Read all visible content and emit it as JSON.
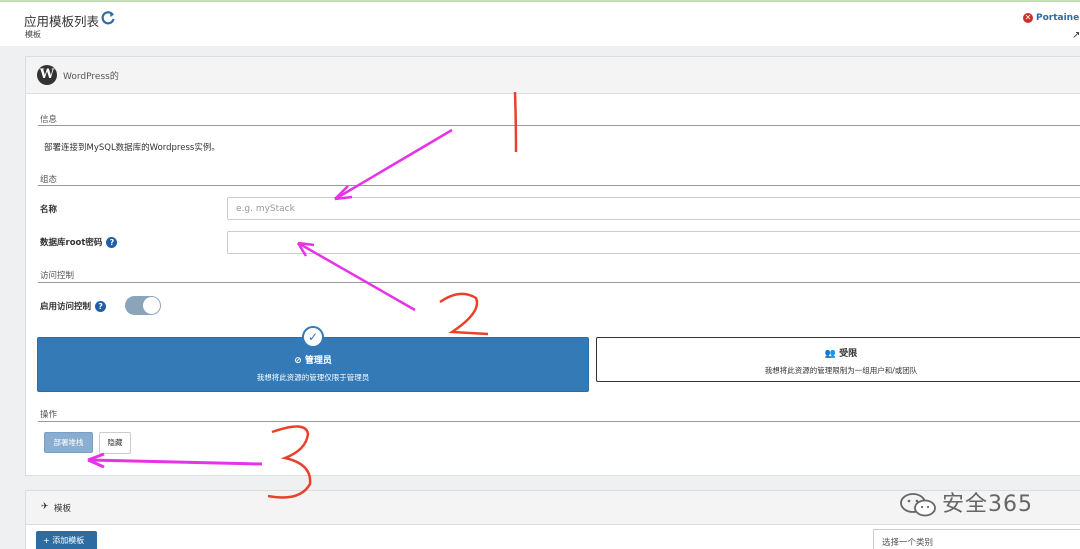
{
  "header": {
    "title": "应用模板列表",
    "breadcrumb": "模板",
    "portainer_link": "Portaine"
  },
  "template": {
    "name": "WordPress的",
    "info_label": "信息",
    "description": "部署连接到MySQL数据库的Wordpress实例。",
    "config_label": "组态",
    "name_label": "名称",
    "name_placeholder": "e.g. myStack",
    "name_value": "",
    "db_password_label": "数据库root密码",
    "db_password_value": "",
    "access_control_label": "访问控制",
    "enable_access_control_label": "启用访问控制",
    "enable_access_control": true,
    "options": {
      "admin_title": "管理员",
      "admin_desc": "我想将此资源的管理仅限于管理员",
      "restricted_title": "受限",
      "restricted_desc": "我想将此资源的管理限制为一组用户和/或团队",
      "selected": "admin"
    },
    "actions_label": "操作",
    "deploy_button": "部署堆栈",
    "hide_button": "隐藏"
  },
  "templates": {
    "title": "模板",
    "add_button": "添加模板",
    "category_select": "选择一个类别"
  },
  "watermark": "安全365",
  "colors": {
    "primary": "#337ab7",
    "annotation_arrow": "#e633e6",
    "annotation_number": "#e8422c"
  },
  "icons": {
    "refresh": "refresh-icon",
    "wordpress": "wordpress-logo",
    "help": "question-circle-icon",
    "eye_slash": "eye-slash-icon",
    "users": "users-icon",
    "rocket": "rocket-icon",
    "plus": "plus-icon",
    "check": "check-circle-icon"
  }
}
